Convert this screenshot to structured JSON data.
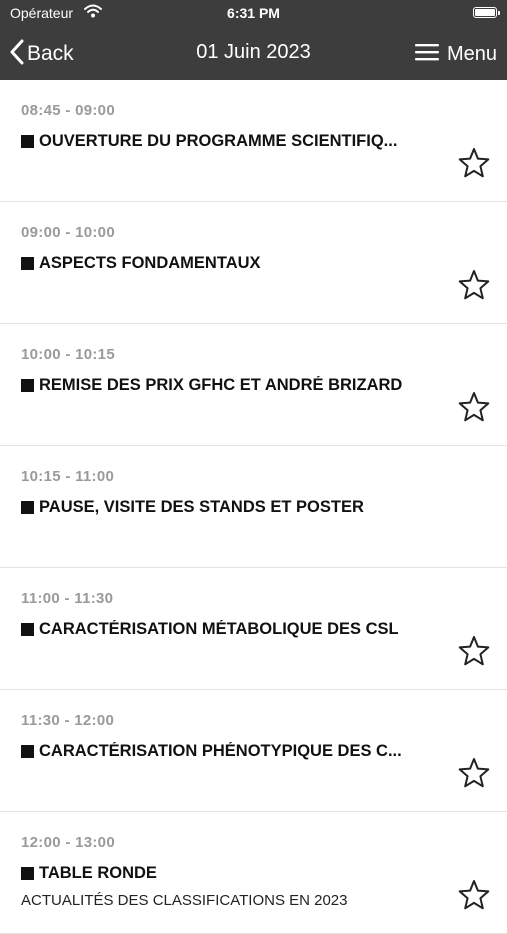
{
  "status_bar": {
    "carrier": "Opérateur",
    "time": "6:31 PM",
    "wifi_icon": "wifi-icon",
    "battery_icon": "battery-icon"
  },
  "nav": {
    "back_label": "Back",
    "title": "01 Juin 2023",
    "menu_label": "Menu"
  },
  "sessions": [
    {
      "time": "08:45 - 09:00",
      "title": "OUVERTURE DU PROGRAMME SCIENTIFIQ...",
      "subtitle": "",
      "favorite_icon": "star-outline-icon",
      "has_star": true
    },
    {
      "time": "09:00 - 10:00",
      "title": "ASPECTS FONDAMENTAUX",
      "subtitle": "",
      "favorite_icon": "star-outline-icon",
      "has_star": true
    },
    {
      "time": "10:00 - 10:15",
      "title": "REMISE DES PRIX GFHC ET ANDRÉ BRIZARD",
      "subtitle": "",
      "favorite_icon": "star-outline-icon",
      "has_star": true
    },
    {
      "time": "10:15 - 11:00",
      "title": "PAUSE, VISITE DES STANDS ET POSTER",
      "subtitle": "",
      "favorite_icon": "",
      "has_star": false
    },
    {
      "time": "11:00 - 11:30",
      "title": "CARACTÉRISATION MÉTABOLIQUE DES CSL",
      "subtitle": "",
      "favorite_icon": "star-outline-icon",
      "has_star": true
    },
    {
      "time": "11:30 - 12:00",
      "title": "CARACTÉRISATION PHÉNOTYPIQUE DES C...",
      "subtitle": "",
      "favorite_icon": "star-outline-icon",
      "has_star": true
    },
    {
      "time": "12:00 - 13:00",
      "title": "TABLE RONDE",
      "subtitle": "ACTUALITÉS DES CLASSIFICATIONS EN 2023",
      "favorite_icon": "star-outline-icon",
      "has_star": true
    }
  ],
  "colors": {
    "bar_background": "#3d3d3d",
    "time_text": "#9a9a9a",
    "title_text": "#111111",
    "divider": "#e3e3e3"
  }
}
